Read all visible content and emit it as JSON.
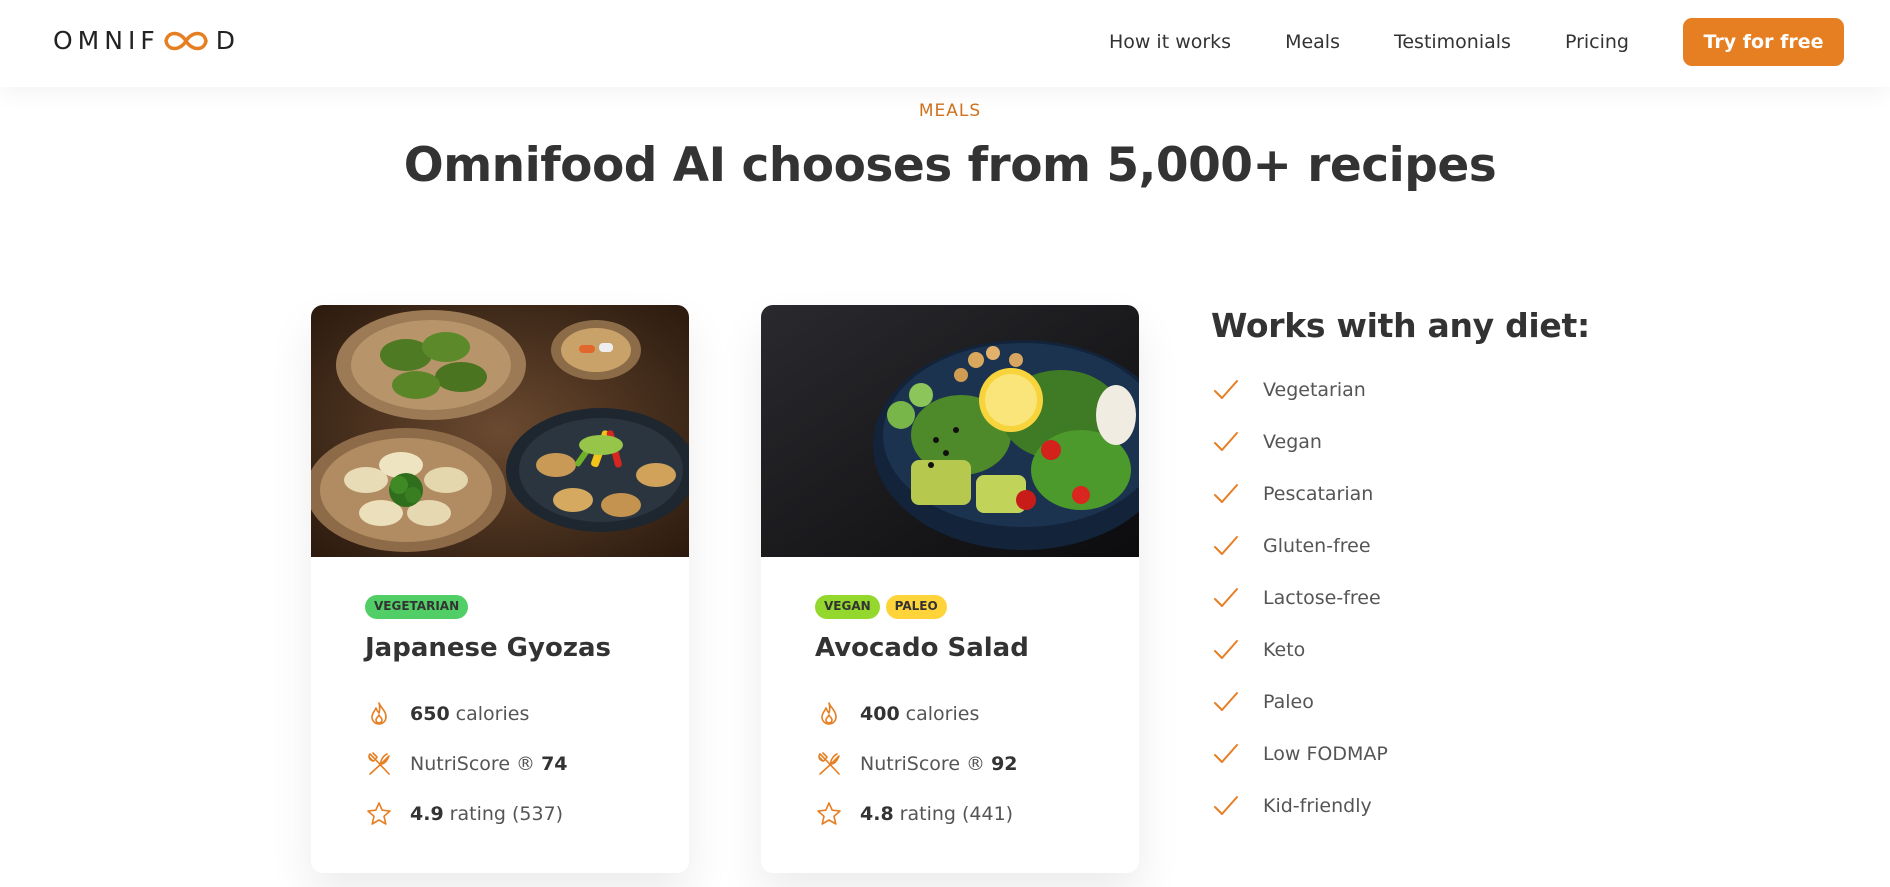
{
  "header": {
    "logo_text_left": "OMNIF",
    "logo_text_right": "D",
    "nav": [
      {
        "label": "How it works"
      },
      {
        "label": "Meals"
      },
      {
        "label": "Testimonials"
      },
      {
        "label": "Pricing"
      }
    ],
    "cta_label": "Try for free"
  },
  "section": {
    "subheading": "MEALS",
    "heading": "Omnifood AI chooses from 5,000+ recipes"
  },
  "meals": [
    {
      "tags": [
        {
          "label": "Vegetarian",
          "color": "#51cf66"
        }
      ],
      "title": "Japanese Gyozas",
      "calories_value": "650",
      "calories_label": "calories",
      "nutri_label": "NutriScore ®",
      "nutri_value": "74",
      "rating_value": "4.9",
      "rating_label": "rating (537)"
    },
    {
      "tags": [
        {
          "label": "Vegan",
          "color": "#94d82d"
        },
        {
          "label": "Paleo",
          "color": "#ffd43b"
        }
      ],
      "title": "Avocado Salad",
      "calories_value": "400",
      "calories_label": "calories",
      "nutri_label": "NutriScore ®",
      "nutri_value": "92",
      "rating_value": "4.8",
      "rating_label": "rating (441)"
    }
  ],
  "diets": {
    "title": "Works with any diet:",
    "items": [
      {
        "label": "Vegetarian"
      },
      {
        "label": "Vegan"
      },
      {
        "label": "Pescatarian"
      },
      {
        "label": "Gluten-free"
      },
      {
        "label": "Lactose-free"
      },
      {
        "label": "Keto"
      },
      {
        "label": "Paleo"
      },
      {
        "label": "Low FODMAP"
      },
      {
        "label": "Kid-friendly"
      }
    ]
  },
  "colors": {
    "accent": "#e67e22",
    "accent_dark": "#cf711f",
    "text": "#333333"
  },
  "icons": {
    "calories": "flame-icon",
    "nutriscore": "fork-knife-icon",
    "rating": "star-icon",
    "diet": "checkmark-icon"
  }
}
